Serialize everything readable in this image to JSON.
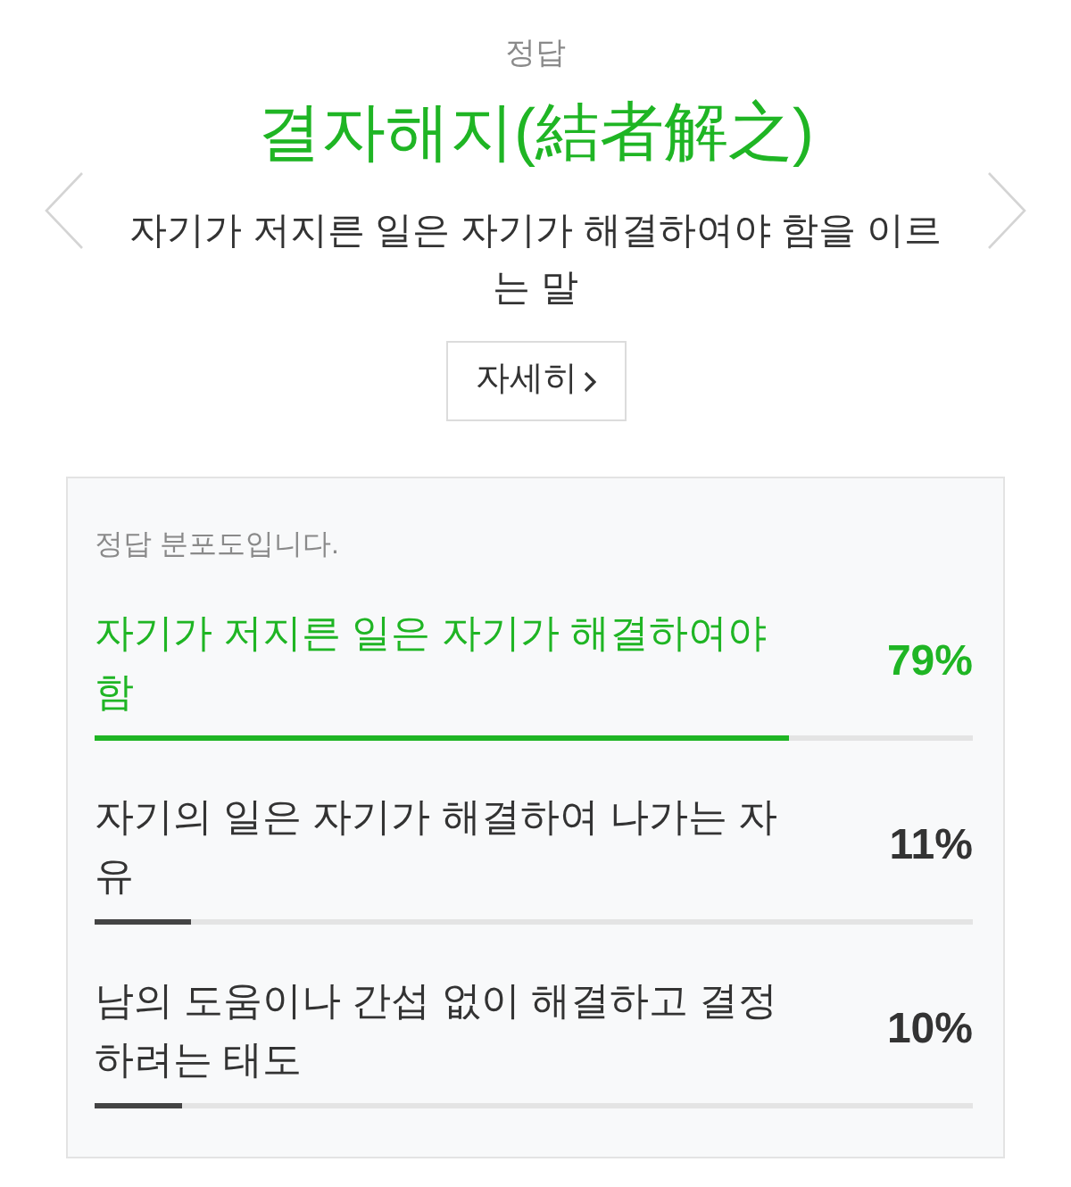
{
  "answer": {
    "label": "정답",
    "title": "결자해지(結者解之)",
    "meaning": "자기가 저지른 일은 자기가 해결하여야 함을 이르는 말",
    "details_button": "자세히"
  },
  "distribution": {
    "title": "정답 분포도입니다.",
    "options": [
      {
        "text": "자기가 저지른 일은 자기가 해결하여야 함",
        "percent": "79%",
        "level": 0.79,
        "correct": true
      },
      {
        "text": "자기의 일은 자기가 해결하여 나가는 자유",
        "percent": "11%",
        "level": 0.11,
        "correct": false
      },
      {
        "text": "남의 도움이나 간섭 없이 해결하고 결정하려는 태도",
        "percent": "10%",
        "level": 0.1,
        "correct": false
      }
    ]
  }
}
